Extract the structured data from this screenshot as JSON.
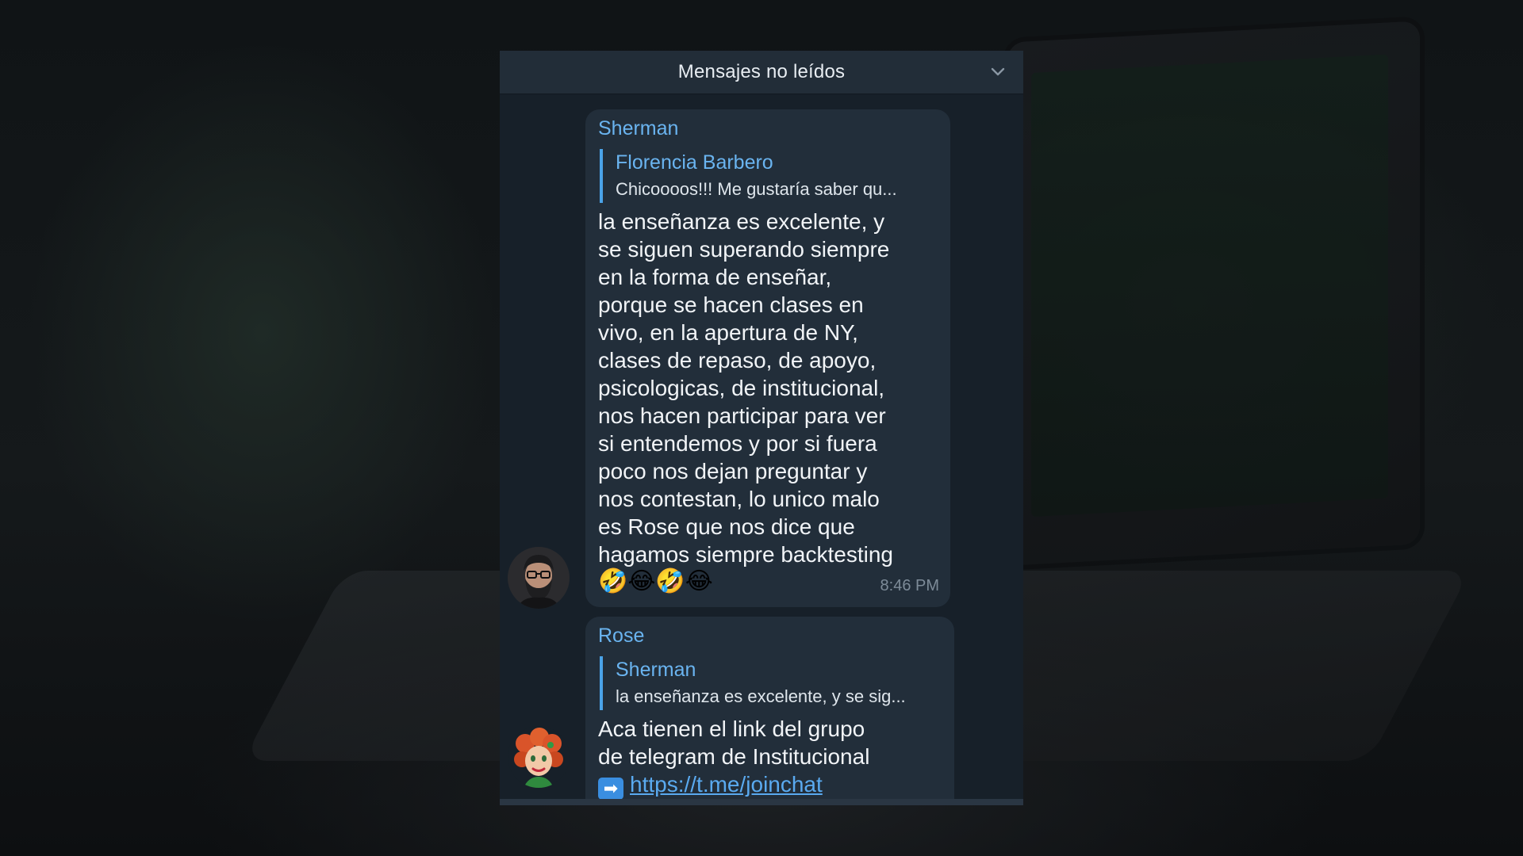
{
  "header": {
    "title": "Mensajes no leídos",
    "collapse_icon": "chevron-down-icon"
  },
  "messages": [
    {
      "sender": "Sherman",
      "avatar_icon": "bearded-man-avatar",
      "reply": {
        "name": "Florencia Barbero",
        "text": "Chicoooos!!! Me gustaría saber qu..."
      },
      "lines": [
        "la enseñanza es excelente, y",
        "se siguen superando siempre",
        "en la forma de enseñar,",
        "porque se hacen clases en",
        "vivo, en la apertura de NY,",
        "clases de repaso, de apoyo,",
        "psicologicas, de institucional,",
        "nos hacen participar para ver",
        "si entendemos y por si fuera",
        "poco nos dejan preguntar y",
        "nos contestan, lo unico malo",
        "es Rose que nos dice que",
        "hagamos siempre backtesting"
      ],
      "emojis": "🤣😂🤣😂",
      "time": "8:46 PM"
    },
    {
      "sender": "Rose",
      "avatar_icon": "redhead-woman-avatar",
      "reply": {
        "name": "Sherman",
        "text": "la enseñanza es excelente, y se sig..."
      },
      "lines": [
        "Aca tienen el link del grupo",
        "de telegram de Institucional"
      ],
      "arrow_icon": "➡",
      "link": "https://t.me/joinchat"
    }
  ],
  "colors": {
    "panel_bg": "#172029",
    "header_bg": "#222d38",
    "bubble_bg": "#222e3a",
    "accent": "#6ab4f0"
  }
}
